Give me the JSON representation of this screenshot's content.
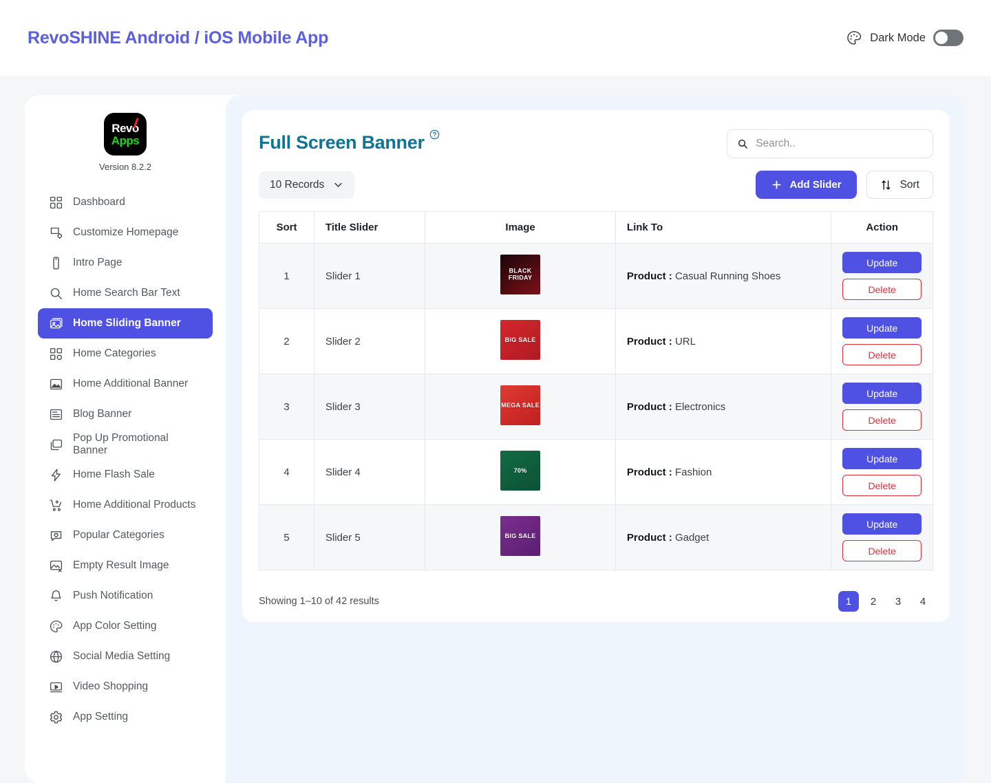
{
  "header": {
    "app_title": "RevoSHINE Android / iOS Mobile App",
    "dark_mode_label": "Dark Mode",
    "palette_icon": "palette-icon",
    "toggle_state": "off"
  },
  "sidebar": {
    "logo_line1": "Revo",
    "logo_line2": "Apps",
    "version": "Version 8.2.2",
    "items": [
      {
        "label": "Dashboard",
        "icon": "dashboard-icon",
        "active": false
      },
      {
        "label": "Customize Homepage",
        "icon": "customize-icon",
        "active": false
      },
      {
        "label": "Intro Page",
        "icon": "mobile-icon",
        "active": false
      },
      {
        "label": "Home Search Bar Text",
        "icon": "search-icon",
        "active": false
      },
      {
        "label": "Home Sliding Banner",
        "icon": "images-icon",
        "active": true
      },
      {
        "label": "Home Categories",
        "icon": "grid-icon",
        "active": false
      },
      {
        "label": "Home Additional Banner",
        "icon": "image-icon",
        "active": false
      },
      {
        "label": "Blog Banner",
        "icon": "article-icon",
        "active": false
      },
      {
        "label": "Pop Up Promotional Banner",
        "icon": "popup-icon",
        "active": false
      },
      {
        "label": "Home Flash Sale",
        "icon": "bolt-icon",
        "active": false
      },
      {
        "label": "Home Additional Products",
        "icon": "cart-plus-icon",
        "active": false
      },
      {
        "label": "Popular Categories",
        "icon": "heart-chat-icon",
        "active": false
      },
      {
        "label": "Empty Result Image",
        "icon": "image-x-icon",
        "active": false
      },
      {
        "label": "Push Notification",
        "icon": "bell-icon",
        "active": false
      },
      {
        "label": "App Color Setting",
        "icon": "palette-icon",
        "active": false
      },
      {
        "label": "Social Media Setting",
        "icon": "globe-icon",
        "active": false
      },
      {
        "label": "Video Shopping",
        "icon": "video-icon",
        "active": false
      },
      {
        "label": "App Setting",
        "icon": "gear-icon",
        "active": false
      }
    ]
  },
  "main": {
    "title": "Full Screen Banner",
    "help_icon": "question-circle-icon",
    "search": {
      "value": "",
      "placeholder": "Search.."
    },
    "records_select": "10 Records",
    "add_button": "Add Slider",
    "sort_button": "Sort",
    "table": {
      "columns": [
        "Sort",
        "Title Slider",
        "Image",
        "Link To",
        "Action"
      ],
      "rows": [
        {
          "sort": "1",
          "title": "Slider 1",
          "image_caption": "BLACK FRIDAY",
          "image_color_a": "#1a0508",
          "image_color_b": "#7d1018",
          "link_label": "Product :",
          "link_value": "Casual Running Shoes",
          "update": "Update",
          "delete": "Delete"
        },
        {
          "sort": "2",
          "title": "Slider 2",
          "image_caption": "BIG SALE",
          "image_color_a": "#d6262c",
          "image_color_b": "#b01b22",
          "link_label": "Product :",
          "link_value": "URL",
          "update": "Update",
          "delete": "Delete"
        },
        {
          "sort": "3",
          "title": "Slider 3",
          "image_caption": "MEGA SALE",
          "image_color_a": "#e03a33",
          "image_color_b": "#c0201f",
          "link_label": "Product :",
          "link_value": "Electronics",
          "update": "Update",
          "delete": "Delete"
        },
        {
          "sort": "4",
          "title": "Slider 4",
          "image_caption": "70%",
          "image_color_a": "#136c46",
          "image_color_b": "#0c5134",
          "link_label": "Product :",
          "link_value": "Fashion",
          "update": "Update",
          "delete": "Delete"
        },
        {
          "sort": "5",
          "title": "Slider 5",
          "image_caption": "BIG SALE",
          "image_color_a": "#7b2d8e",
          "image_color_b": "#5a1f72",
          "link_label": "Product :",
          "link_value": "Gadget",
          "update": "Update",
          "delete": "Delete"
        }
      ]
    },
    "showing": "Showing 1–10 of 42 results",
    "pagination": [
      {
        "label": "1",
        "active": true
      },
      {
        "label": "2",
        "active": false
      },
      {
        "label": "3",
        "active": false
      },
      {
        "label": "4",
        "active": false
      }
    ]
  },
  "colors": {
    "accent_indigo": "#4f51e3",
    "title_teal": "#0e7397",
    "danger_red": "#dc2f3c",
    "panel_blue": "#eff5fd",
    "page_bg": "#f4f6f8"
  }
}
